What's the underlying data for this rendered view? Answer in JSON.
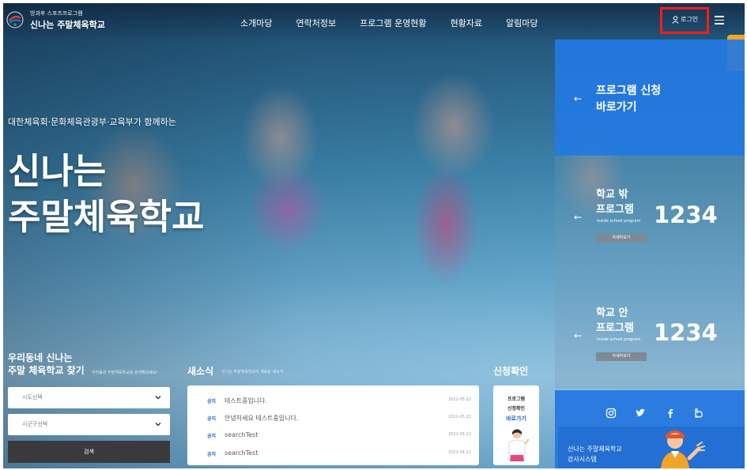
{
  "header": {
    "logo_sub": "방과후 스포츠프로그램",
    "logo_main": "신나는 주말체육학교",
    "nav": [
      "소개마당",
      "연락처정보",
      "프로그램 운영현황",
      "현황자료",
      "알림마당"
    ],
    "login_label": "로그인",
    "highlight_color": "#ff1a1a"
  },
  "hero": {
    "sub": "대한체육회·문화체육관광부·교육부가 함께하는",
    "title_line1": "신나는",
    "title_line2": "주말체육학교"
  },
  "panels": {
    "apply": {
      "line1": "프로그램 신청",
      "line2": "바로가기",
      "bg": "#247ae2"
    },
    "outside": {
      "line1": "학교 밖",
      "line2": "프로그램",
      "sub": "inside school program",
      "count": "1234",
      "button": "자세히보기"
    },
    "inside": {
      "line1": "학교 안",
      "line2": "프로그램",
      "sub": "inside school program",
      "count": "1234",
      "button": "자세히보기"
    }
  },
  "find": {
    "title_line1": "우리동네 신나는",
    "title_line2": "주말 체육학교 찾기",
    "desc": "우리동네 주말체육학교를 검색해보세요!",
    "select1": "시도선택",
    "select2": "시군구선택",
    "search": "검색"
  },
  "news": {
    "title": "새소식",
    "desc": "신나는 주말체육학교의 새로운 새소식",
    "items": [
      {
        "tag": "공지",
        "text": "테스트중입니다.",
        "date": "2022-05-22"
      },
      {
        "tag": "공지",
        "text": "안녕하세요 테스트중입니다.",
        "date": "2022-05-22"
      },
      {
        "tag": "공지",
        "text": "searchTest",
        "date": "2022-05-22"
      },
      {
        "tag": "공지",
        "text": "searchTest",
        "date": "2022-04-22"
      }
    ]
  },
  "confirm": {
    "title": "신청확인",
    "line1": "프로그램",
    "line2": "신청확인",
    "link": "바로가기"
  },
  "footer_right": {
    "social": [
      "instagram-icon",
      "twitter-icon",
      "facebook-icon",
      "blog-icon"
    ],
    "line1": "신나는 주말체육학교",
    "line2": "강사시스템"
  }
}
